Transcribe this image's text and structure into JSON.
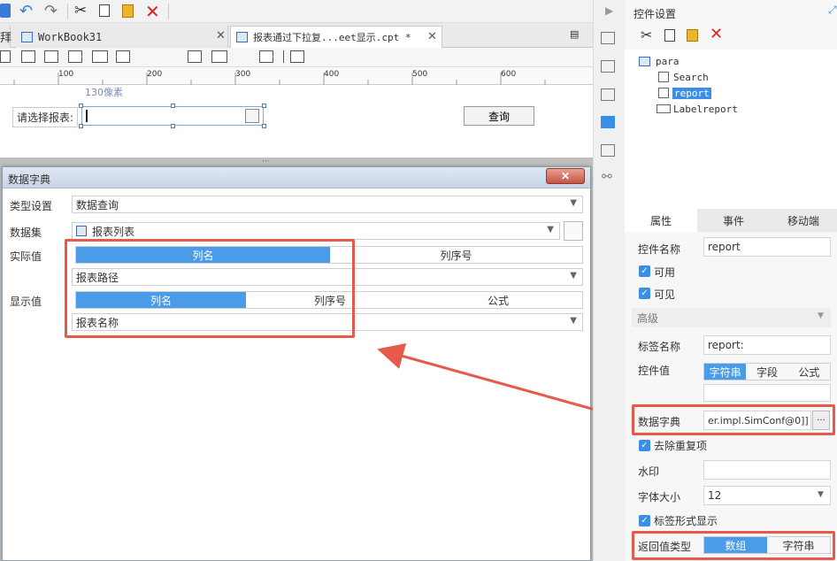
{
  "tabs": [
    {
      "label": "WorkBook31"
    },
    {
      "label": "报表通过下拉复...eet显示.cpt *"
    }
  ],
  "ruler": {
    "ticks": [
      "100",
      "200",
      "300",
      "400",
      "500",
      "600"
    ]
  },
  "canvas": {
    "width_hint": "130像素",
    "select_label": "请选择报表:",
    "query_button": "查询"
  },
  "dialog": {
    "title": "数据字典",
    "type_label": "类型设置",
    "type_value": "数据查询",
    "dataset_label": "数据集",
    "dataset_value": "报表列表",
    "actual_label": "实际值",
    "actual_tabs": [
      "列名",
      "列序号"
    ],
    "actual_value": "报表路径",
    "display_label": "显示值",
    "display_tabs": [
      "列名",
      "列序号",
      "公式"
    ],
    "display_value": "报表名称"
  },
  "panel": {
    "title": "控件设置",
    "tree": {
      "root": "para",
      "children": [
        "Search",
        "report",
        "Labelreport"
      ]
    },
    "tabs": [
      "属性",
      "事件",
      "移动端"
    ],
    "name_label": "控件名称",
    "name_value": "report",
    "enabled_label": "可用",
    "visible_label": "可见",
    "advanced_label": "高级",
    "tag_label": "标签名称",
    "tag_value": "report:",
    "value_label": "控件值",
    "value_tabs": [
      "字符串",
      "字段",
      "公式"
    ],
    "dict_label": "数据字典",
    "dict_value": "er.impl.SimConf@0]]",
    "dict_btn": "···",
    "dedup_label": "去除重复项",
    "watermark_label": "水印",
    "fontsize_label": "字体大小",
    "fontsize_value": "12",
    "tagform_label": "标签形式显示",
    "return_label": "返回值类型",
    "return_tabs": [
      "数组",
      "字符串"
    ]
  },
  "colors": {
    "accent": "#4a9be8",
    "highlight": "#e55a4a"
  }
}
